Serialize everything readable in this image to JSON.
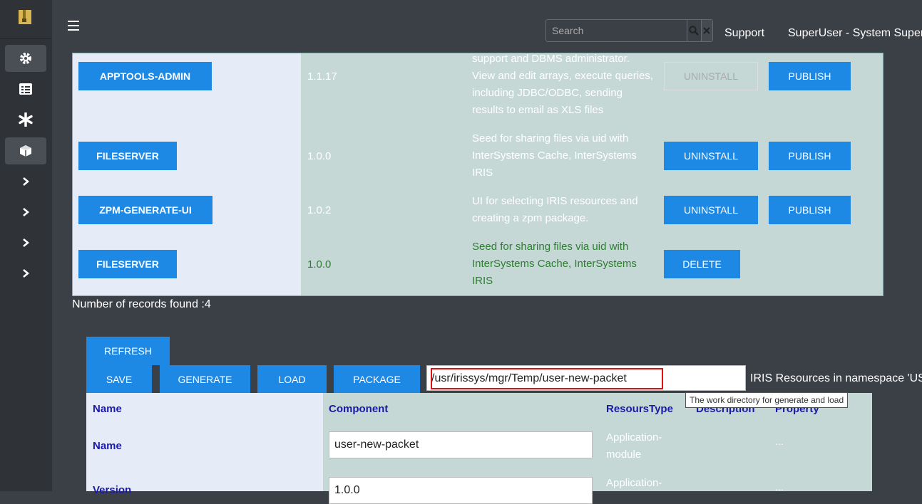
{
  "sidebar": {
    "logo": "archive-icon",
    "items": [
      {
        "icon": "gear-icon",
        "active": true
      },
      {
        "icon": "list-icon",
        "active": false
      },
      {
        "icon": "asterisk-icon",
        "active": false
      },
      {
        "icon": "cube-icon",
        "active": true
      },
      {
        "icon": "chevron-right-icon",
        "active": false
      },
      {
        "icon": "chevron-right-icon",
        "active": false
      },
      {
        "icon": "chevron-right-icon",
        "active": false
      },
      {
        "icon": "chevron-right-icon",
        "active": false
      }
    ]
  },
  "header": {
    "search_placeholder": "Search",
    "support_label": "Support",
    "user_label": "SuperUser - System Super"
  },
  "packages": [
    {
      "name": "APPTOOLS-ADMIN",
      "version": "1.1.17",
      "description": "support and DBMS administrator. View and edit arrays, execute queries, including JDBC/ODBC, sending results to email as XLS files",
      "uninstall": "UNINSTALL",
      "publish": "PUBLISH"
    },
    {
      "name": "FILESERVER",
      "version": "1.0.0",
      "description": "Seed for sharing files via uid with InterSystems Cache, InterSystems IRIS",
      "uninstall": "UNINSTALL",
      "publish": "PUBLISH"
    },
    {
      "name": "ZPM-GENERATE-UI",
      "version": "1.0.2",
      "description": "UI for selecting IRIS resources and creating a zpm package.",
      "uninstall": "UNINSTALL",
      "publish": "PUBLISH"
    },
    {
      "name": "FILESERVER",
      "version": "1.0.0",
      "description": "Seed for sharing files via uid with InterSystems Cache, InterSystems IRIS",
      "delete": "DELETE"
    }
  ],
  "records_text": "Number of records found :4",
  "toolbar": {
    "refresh": "REFRESH",
    "save": "SAVE",
    "generate": "GENERATE",
    "load": "LOAD",
    "package": "PACKAGE",
    "path_value": "/usr/irissys/mgr/Temp/user-new-packet",
    "namespace_label": "IRIS Resources in namespace 'USER",
    "tooltip": "The work directory for generate and load"
  },
  "resources": {
    "headers": [
      "Name",
      "Component",
      "ResoursType",
      "Description",
      "Property"
    ],
    "rows": [
      {
        "label": "Name",
        "value": "user-new-packet",
        "type": "Application-module",
        "dots": "..."
      },
      {
        "label": "Version",
        "value": "1.0.0",
        "type": "Application-",
        "dots": "..."
      }
    ]
  }
}
